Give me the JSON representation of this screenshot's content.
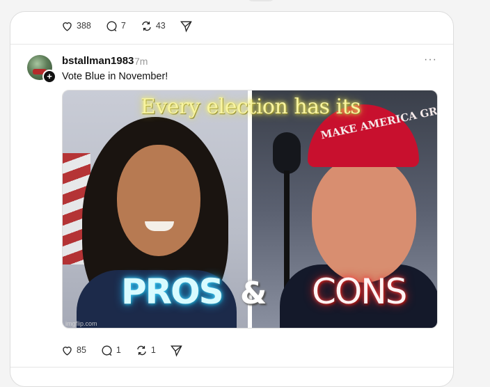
{
  "previous_post": {
    "likes": "388",
    "replies": "7",
    "reposts": "43"
  },
  "post": {
    "username": "bstallman1983",
    "timestamp": "7m",
    "more_glyph": "···",
    "avatar_badge": "+",
    "text": "Vote Blue in November!",
    "image": {
      "title_text": "Every election has its",
      "left_text": "PROS",
      "amp_text": "&",
      "right_text": "CONS",
      "hat_text": "MAKE AMERICA GREAT AGAIN",
      "watermark": "imgflip.com"
    },
    "likes": "85",
    "replies": "1",
    "reposts": "1"
  },
  "icons": [
    "heart-icon",
    "comment-icon",
    "repost-icon",
    "share-icon",
    "more-icon",
    "plus-icon"
  ]
}
